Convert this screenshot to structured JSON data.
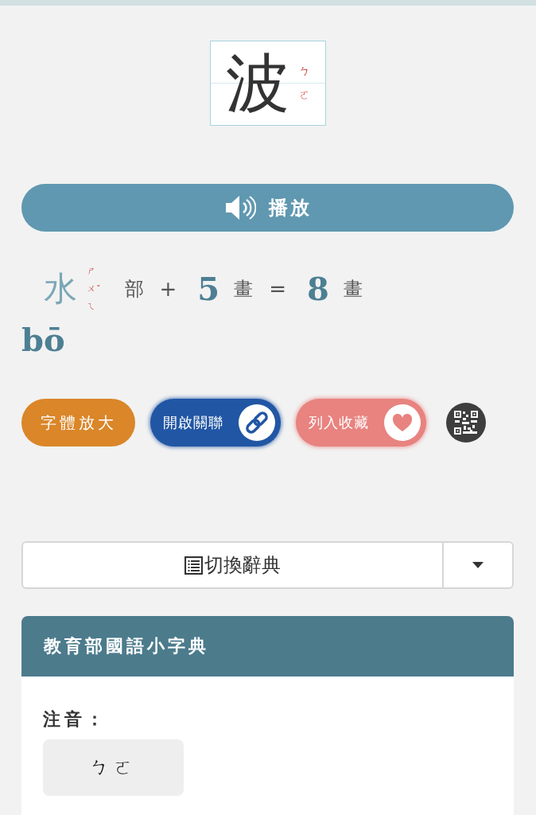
{
  "character": {
    "glyph": "波",
    "zhuyin": "ㄅㄛ"
  },
  "play_button": {
    "label": "播放"
  },
  "strokes": {
    "radical": "水",
    "radical_zhuyin": "ㄕㄨㄟ",
    "radical_tone": "ˇ",
    "radical_suffix": "部",
    "plus": "+",
    "extra_strokes": "5",
    "extra_unit": "畫",
    "equals": "=",
    "total_strokes": "8",
    "total_unit": "畫"
  },
  "pinyin": "bō",
  "actions": [
    {
      "kind": "enlarge",
      "label": "字體放大"
    },
    {
      "kind": "link",
      "label": "開啟關聯"
    },
    {
      "kind": "favorite",
      "label": "列入收藏"
    },
    {
      "kind": "qr"
    }
  ],
  "dictionary_switch": {
    "label": "切換辭典"
  },
  "dictionary": {
    "title": "教育部國語小字典",
    "fields": [
      {
        "label": "注音：",
        "value": "ㄅㄛ"
      }
    ]
  }
}
